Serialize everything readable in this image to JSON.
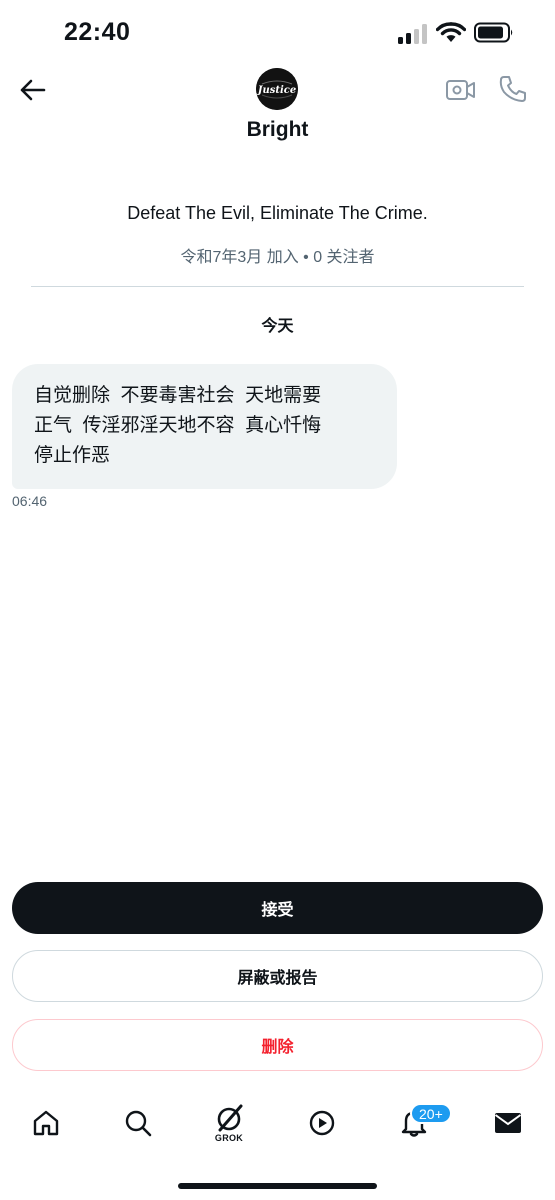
{
  "status_bar": {
    "time": "22:40",
    "icons": [
      "cellular-signal-icon",
      "wifi-icon",
      "battery-icon"
    ]
  },
  "header": {
    "back_icon": "arrow-left-icon",
    "avatar_text": "Justice",
    "name": "Bright",
    "video_icon": "video-camera-icon",
    "call_icon": "phone-icon"
  },
  "profile": {
    "bio": "Defeat The Evil, Eliminate The Crime.",
    "meta": "令和7年3月 加入 • 0 关注者"
  },
  "conversation": {
    "date_separator": "今天",
    "message": {
      "lines": [
        "自觉删除  不要毒害社会  天地需要",
        "正气  传淫邪淫天地不容  真心忏悔",
        "停止作恶"
      ],
      "time": "06:46"
    }
  },
  "actions": {
    "accept": "接受",
    "block_or_report": "屏蔽或报告",
    "delete": "删除"
  },
  "bottom_nav": {
    "grok_label": "GROK",
    "notification_badge": "20+",
    "tabs": [
      "home-icon",
      "search-icon",
      "grok-icon",
      "play-icon",
      "bell-icon",
      "envelope-icon"
    ]
  },
  "colors": {
    "text": "#0f1419",
    "secondary_text": "#536471",
    "bubble": "#eff3f4",
    "danger": "#f4212e",
    "badge": "#1d9bf0"
  }
}
